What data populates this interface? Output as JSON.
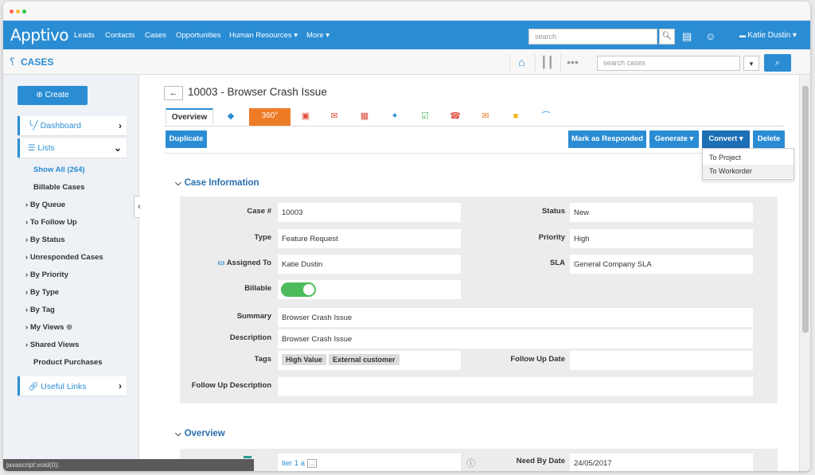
{
  "colors": {
    "accent": "#2a8dd4",
    "tab_360": "#ee7b26",
    "toggle_on": "#4cbb5b",
    "nav_bg": "#2a8dd4"
  },
  "topnav": {
    "logo": "Apptivo",
    "items": [
      "Leads",
      "Contacts",
      "Cases",
      "Opportunities",
      "Human Resources ▾",
      "More ▾"
    ],
    "search_placeholder": "search",
    "user": "Katie Dustin"
  },
  "subbar": {
    "module": "CASES",
    "case_search_placeholder": "search cases"
  },
  "sidebar": {
    "create": "Create",
    "dashboard": "Dashboard",
    "lists": "Lists",
    "items": [
      "Show All (264)",
      "Billable Cases",
      "By Queue",
      "To Follow Up",
      "By Status",
      "Unresponded Cases",
      "By Priority",
      "By Type",
      "By Tag",
      "My Views",
      "Shared Views",
      "Product Purchases"
    ],
    "useful_links": "Useful Links"
  },
  "record": {
    "title": "10003 - Browser Crash Issue",
    "tabs": {
      "overview": "Overview",
      "t360": "360°"
    },
    "buttons": {
      "duplicate": "Duplicate",
      "mark_responded": "Mark as Responded",
      "generate": "Generate ▾",
      "convert": "Convert ▾",
      "delete": "Delete"
    },
    "convert_menu": [
      "To Project",
      "To Workorder"
    ]
  },
  "case_info": {
    "heading": "Case Information",
    "labels": {
      "case_no": "Case #",
      "type": "Type",
      "assigned_to": "Assigned To",
      "billable": "Billable",
      "summary": "Summary",
      "description": "Description",
      "tags": "Tags",
      "follow_up_description": "Follow Up Description",
      "status": "Status",
      "priority": "Priority",
      "sla": "SLA",
      "follow_up_date": "Follow Up Date"
    },
    "values": {
      "case_no": "10003",
      "type": "Feature Request",
      "assigned_to": "Katie Dustin",
      "billable": true,
      "summary": "Browser Crash Issue",
      "description": "Browser Crash Issue",
      "tags": [
        "High Value",
        "External customer"
      ],
      "follow_up_description": "",
      "status": "New",
      "priority": "High",
      "sla": "General Company SLA",
      "follow_up_date": ""
    }
  },
  "overview_section": {
    "heading": "Overview",
    "tier": "tier 1 a",
    "tier_more": "...",
    "need_by_label": "Need By Date",
    "need_by_value": "24/05/2017"
  },
  "statusbar": "javascript:void(0);"
}
